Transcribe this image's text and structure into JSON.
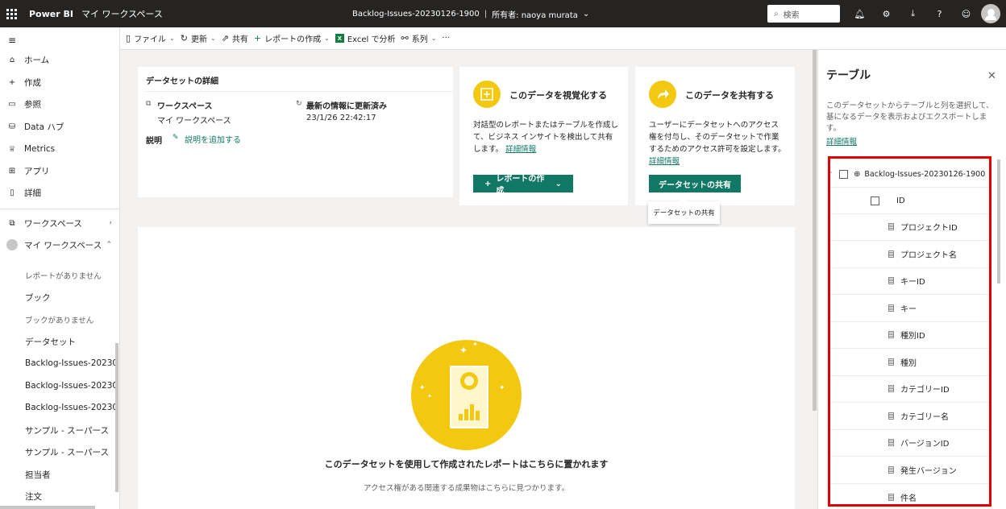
{
  "topbar": {
    "brand": "Power BI",
    "workspace": "マイ ワークスペース",
    "dataset_title": "Backlog-Issues-20230126-1900",
    "separator": "|",
    "owner": "所有者: naoya murata",
    "search_placeholder": "検索"
  },
  "nav": {
    "items": [
      {
        "label": "ホーム",
        "icon": "home-icon"
      },
      {
        "label": "作成",
        "icon": "plus-icon"
      },
      {
        "label": "参照",
        "icon": "folder-icon"
      },
      {
        "label": "Data ハブ",
        "icon": "database-icon"
      },
      {
        "label": "Metrics",
        "icon": "trophy-icon"
      },
      {
        "label": "アプリ",
        "icon": "apps-icon"
      },
      {
        "label": "詳細",
        "icon": "book-icon"
      }
    ],
    "workspaces_label": "ワークスペース",
    "my_workspace_label": "マイ ワークスペース",
    "sub_items": [
      {
        "label": "レポートがありません",
        "muted": true
      },
      {
        "label": "ブック",
        "muted": false
      },
      {
        "label": "ブックがありません",
        "muted": true
      },
      {
        "label": "データセット",
        "muted": false
      },
      {
        "label": "Backlog-Issues-20230",
        "muted": false
      },
      {
        "label": "Backlog-Issues-20230",
        "muted": false
      },
      {
        "label": "Backlog-Issues-20230",
        "muted": false
      },
      {
        "label": "サンプル - スーパース",
        "muted": false
      },
      {
        "label": "サンプル - スーパース",
        "muted": false
      },
      {
        "label": "担当者",
        "muted": false
      },
      {
        "label": "注文",
        "muted": false
      }
    ]
  },
  "toolbar": {
    "file": "ファイル",
    "refresh": "更新",
    "share": "共有",
    "create_report": "レポートの作成",
    "analyze_excel": "Excel で分析",
    "lineage": "系列",
    "more": "···"
  },
  "details": {
    "title": "データセットの詳細",
    "workspace_label": "ワークスペース",
    "workspace_value": "マイ ワークスペース",
    "refresh_label": "最新の情報に更新済み",
    "refresh_value": "23/1/26 22:42:17",
    "description_label": "説明",
    "add_description": "説明を追加する"
  },
  "visualize": {
    "title": "このデータを視覚化する",
    "desc": "対話型のレポートまたはテーブルを作成して、ビジネス インサイトを検出して共有します。",
    "link": "詳細情報",
    "button": "レポートの作成"
  },
  "share": {
    "title": "このデータを共有する",
    "desc": "ユーザーにデータセットへのアクセス権を付与し、そのデータセットで作業するためのアクセス許可を設定します。",
    "link": "詳細情報",
    "button": "データセットの共有",
    "tooltip": "データセットの共有"
  },
  "empty": {
    "title": "このデータセットを使用して作成されたレポートはこちらに置かれます",
    "subtitle": "アクセス権がある関連する成果物はこちらに見つかります。"
  },
  "panel": {
    "title": "テーブル",
    "description": "このデータセットからテーブルと列を選択して、基になるデータを表示およびエクスポートします。",
    "link": "詳細情報",
    "table_name": "Backlog-Issues-20230126-1900",
    "fields": [
      "ID",
      "プロジェクトID",
      "プロジェクト名",
      "キーID",
      "キー",
      "種別ID",
      "種別",
      "カテゴリーID",
      "カテゴリー名",
      "バージョンID",
      "発生バージョン",
      "件名"
    ]
  },
  "colors": {
    "accent": "#117865",
    "topbar": "#252423",
    "yellow": "#f2c811",
    "highlight": "#e00000"
  }
}
